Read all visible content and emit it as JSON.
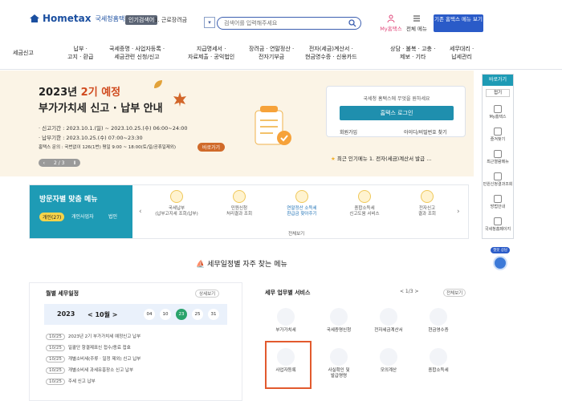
{
  "header": {
    "logo_text": "Hometax",
    "logo_sub": "국세청홈택스",
    "pop_label": "인기검색어",
    "pop_item": "1. 근로장려금",
    "search_placeholder": "검색어를 입력해주세요",
    "my_hometax": "My홈택스",
    "menu_all": "전체 메뉴",
    "default_menu": "기존 홈택스 메뉴 보기"
  },
  "gnb": [
    {
      "label": "세금신고"
    },
    {
      "label": "납부 ·\n고지 · 환급"
    },
    {
      "label": "국세증명 · 사업자등록 ·\n세금관련 신청/신고"
    },
    {
      "label": "지급명세서 ·\n자료제출 · 공익법인"
    },
    {
      "label": "장려금 · 연말정산 ·\n전자기부금"
    },
    {
      "label": "전자(세금)계산서 ·\n현금영수증 · 신용카드"
    },
    {
      "label": "상담 · 불복 · 고충 ·\n제보 · 기타"
    },
    {
      "label": "세무대리 ·\n납세관리"
    }
  ],
  "banner": {
    "year_prefix": "2023년 ",
    "year_highlight": "2기 예정",
    "main": "부가가치세 신고 · 납부 안내",
    "line1": "· 신고기간 : 2023.10.1.(일) ~ 2023.10.25.(수) 06:00~24:00",
    "line2": "· 납부기한 : 2023.10.25.(수) 07:00~23:30",
    "line3": "홈택스 문의 : 국번없이 126(1번) 평일 9:00 ~ 18:00(토/일/공휴일제외)",
    "shortcut": "바로가기",
    "pager": "2 / 3"
  },
  "login": {
    "msg": "국세청 홈택스에 무엇을 원하세요",
    "btn": "홈택스 로그인",
    "join": "회원가입",
    "find": "아이디/비밀번호 찾기",
    "recent": "최근 인기메뉴   1. 전자(세금)계산서 발급  ..."
  },
  "visitor": {
    "title": "방문자별 맞춤 메뉴",
    "tabs": [
      "개인(27)",
      "개인사업자",
      "법인"
    ],
    "items": [
      "국세납부\n(납부고지세 조회/납부)",
      "민원신청\n처리결과 조회",
      "연말정산 소득세\n환급금 찾아주기",
      "종합소득세\n신고도움 서비스",
      "전자신고\n결과 조회"
    ],
    "all": "전체보기"
  },
  "freq_title": "세무일정별 자주 찾는 메뉴",
  "monthly": {
    "title": "월별 세무일정",
    "more": "상세보기",
    "year": "2023",
    "month": "< 10월 >",
    "days": [
      "04",
      "10",
      "23",
      "25",
      "31"
    ],
    "active_day": "23",
    "schedules": [
      {
        "d": "10/25",
        "t": "2023년 2기 부가가치세 예정신고 납부"
      },
      {
        "d": "10/25",
        "t": "일괄단 항결제표신 접수/종료 접효"
      },
      {
        "d": "10/25",
        "t": "개별소비세(주류ㆍ일정 제외) 신고 납부"
      },
      {
        "d": "10/25",
        "t": "개별소비세 과세유흥장소 신고 납부"
      },
      {
        "d": "10/25",
        "t": "주세 신고 납부"
      }
    ]
  },
  "biz": {
    "title": "세무 업무별 서비스",
    "pager": "< 1/3 >",
    "all": "전체보기",
    "services": [
      "부가가치세",
      "국세증명신청",
      "전자세금계산서",
      "현금영수증",
      "사업자등록",
      "사실확인 및\n발급명령",
      "모의계산",
      "종합소득세"
    ]
  },
  "quick": {
    "title": "바로가기",
    "select": "접기",
    "items": [
      "My홈택스",
      "즐겨찾기",
      "최근열람메뉴",
      "민원신청결과조회",
      "방법안내",
      "국세청홈페이지"
    ]
  },
  "chatbot": {
    "label": "챗봇 상담"
  },
  "colors": {
    "brand": "#2a5bc8",
    "teal": "#1e9bb5",
    "highlight": "#e25a2e"
  }
}
